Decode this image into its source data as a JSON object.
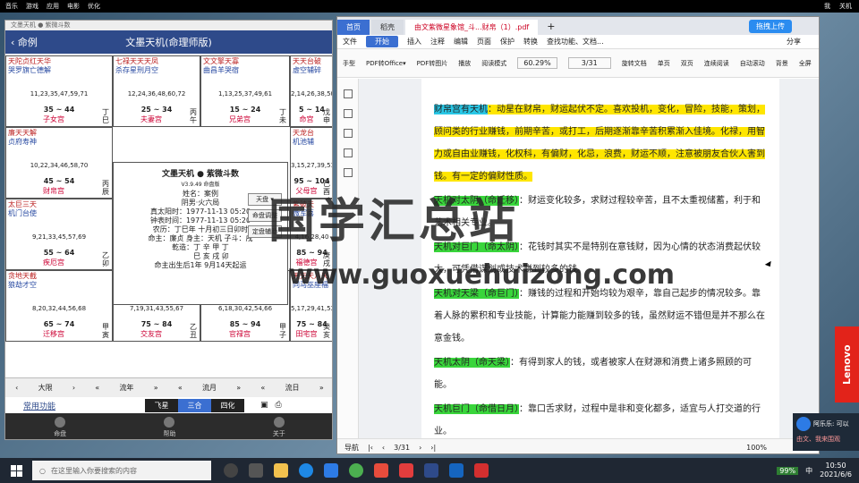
{
  "desktop_bar": {
    "items": [
      "音乐",
      "游戏",
      "应用",
      "电影",
      "优化"
    ],
    "right": [
      "我",
      "关机"
    ]
  },
  "left_app": {
    "window_title": "文墨天机 ● 紫微斗数",
    "back_label": "命例",
    "title": "文墨天机(命理师版)",
    "palaces": [
      {
        "stars": "天陀贞红天华",
        "stars2": "哭罗旗亡德解",
        "nums": "11,23,35,47,59,71",
        "range": "35 ~ 44",
        "gz": "丁巳",
        "name": "子女宫"
      },
      {
        "stars": "七禄天天天凤",
        "stars2": "杀存星刑月空",
        "nums": "12,24,36,48,60,72",
        "range": "25 ~ 34",
        "gz": "丙午",
        "name": "夫妻宫"
      },
      {
        "stars": "文文擎天寡",
        "stars2": "曲昌羊哭宿",
        "nums": "1,13,25,37,49,61",
        "range": "15 ~ 24",
        "gz": "丁未",
        "name": "兄弟宫"
      },
      {
        "stars": "天天台破",
        "stars2": "虚空辅碎",
        "nums": "2,14,26,38,50",
        "range": "5 ~ 14",
        "gz": "戊申",
        "name": "命宫"
      },
      {
        "stars": "廉天天解",
        "stars2": "贞府寿神",
        "nums": "10,22,34,46,58,70",
        "range": "45 ~ 54",
        "gz": "丙辰",
        "name": "财帛宫"
      },
      {
        "stars": "天龙台",
        "stars2": "机池辅",
        "nums": "3,15,27,39,51",
        "range": "95 ~ 104",
        "gz": "己酉",
        "name": "父母宫"
      },
      {
        "stars": "太巨三天",
        "stars2": "机门台使",
        "nums": "9,21,33,45,57,69",
        "range": "55 ~ 64",
        "gz": "乙卯",
        "name": "疾厄宫"
      },
      {
        "stars": "紫破天",
        "stars2": "微军喜",
        "nums": "4,16,28,40",
        "range": "85 ~ 94",
        "gz": "庚戌",
        "name": "福德宫"
      },
      {
        "stars": "贪地天截",
        "stars2": "狼劫才空",
        "nums": "8,20,32,44,56,68",
        "range": "65 ~ 74",
        "gz": "甲寅",
        "name": "迁移宫"
      },
      {
        "stars": "太太左右铃",
        "stars2": "阳阴辅弼星",
        "nums": "7,19,31,43,55,67",
        "range": "75 ~ 84",
        "gz": "乙丑",
        "name": "交友宫"
      },
      {
        "stars": "武天阳龙",
        "stars2": "曲府刃德",
        "nums": "6,18,30,42,54,66",
        "range": "85 ~ 94",
        "gz": "甲子",
        "name": "官禄宫"
      },
      {
        "stars": "天天天八天",
        "stars2": "同马巫座福",
        "nums": "5,17,29,41,53",
        "range": "75 ~ 84",
        "gz": "癸亥",
        "name": "田宅宫"
      }
    ],
    "center": {
      "title": "文墨天机 ● 紫微斗数",
      "sub": "V3.9.49 命盘版",
      "lines": [
        "姓名：案例",
        "阴男·火六局",
        "真太阳时：1977-11-13 05:20",
        "钟表时间：1977-11-13 05:20",
        "农历：丁巳年 十月初三日卯时",
        "命主：廉贞  身主：天机  子斗：戌",
        "乾造：丁  辛  甲  丁",
        "　　　巳  亥  戌  卯",
        "命主出生后1年 9月14天起运"
      ],
      "btn1": "天盘 ▾",
      "btn2": "命盘调整",
      "btn3": "定盘辅助"
    },
    "nav": [
      "‹",
      "大限",
      "›",
      "«",
      "流年",
      "»",
      "«",
      "流月",
      "»",
      "«",
      "流日",
      "»"
    ],
    "tools": {
      "common": "常用功能",
      "seg": [
        "飞星",
        "三合",
        "四化"
      ]
    },
    "bottom": [
      "命盘",
      "帮助",
      "关于"
    ]
  },
  "right_app": {
    "tabs": {
      "home": "首页",
      "t2": "稻壳",
      "t3": "由文紫微星象馆_斗...财帛（1）.pdf",
      "upload": "拖拽上传"
    },
    "menu": [
      "文件",
      "开始",
      "插入",
      "注释",
      "编辑",
      "页面",
      "保护",
      "转换",
      "查找功能、文档...",
      "分享"
    ],
    "toolbar": [
      "手型",
      "选择",
      "PDF转Office▾",
      "PDF转图片",
      "播放",
      "阅读模式",
      "旋转文档",
      "单页",
      "双页",
      "连续阅读",
      "自动滚动",
      "背景",
      "全屏"
    ],
    "zoom": "60.29%",
    "page_box": "3/31",
    "paragraphs": [
      {
        "hl": "财帛宫有天机",
        "hlc": "hlC",
        "text": "：动星在财帛，财运起伏不定。喜欢投机，变化，冒险，技能，策划，顾问类的行业赚钱，前期辛苦，或打工，后期逐渐靠辛苦积累渐入佳境。化禄，用智力或自由业赚钱，化权科，有偏财，化忌，浪费，财运不顺，注意被朋友合伙人害到钱。有一定的偏财性质。",
        "bg": "hlY"
      },
      {
        "hl": "天机对太阴（命迁移）",
        "hlc": "hlG",
        "text": "：财运变化较多，求财过程较辛苦，且不太重视储蓄，利于和艺术相关专业。",
        "bg": ""
      },
      {
        "hl": "天机对巨门（命太阴）",
        "hlc": "hlG",
        "text": "：花钱时其实不是特别在意钱财，因为心情的状态消费起伏较大，可凭借谋划或技术赚到较多的钱。",
        "bg": ""
      },
      {
        "hl": "天机对天梁（命巨门）",
        "hlc": "hlG",
        "text": "：赚钱的过程和开始均较为艰辛，靠自己起步的情况较多。靠着人脉的累积和专业技能，计算能力能赚到较多的钱，虽然财运不错但是并不那么在意金钱。",
        "bg": ""
      },
      {
        "hl": "天机太阴（命天梁）",
        "hlc": "hlG",
        "text": "：有得到家人的钱，或者被家人在财源和消费上诸多照顾的可能。",
        "bg": ""
      },
      {
        "hl": "天机巨门（命借日月）",
        "hlc": "hlG",
        "text": "：靠口舌求财，过程中是非和变化都多，适宜与人打交道的行业。",
        "bg": ""
      }
    ],
    "status": {
      "nav": "导航",
      "page": "3/31",
      "zoom": "100%"
    }
  },
  "watermark": {
    "cn": "国学汇总站",
    "url": "www.guoxuehuizong.com"
  },
  "notification": {
    "text": "阿乐乐: 可以",
    "sub": "由文、我来围观"
  },
  "taskbar": {
    "search": "在这里输入你要搜索的内容",
    "battery": "99%",
    "time": "10:50",
    "date": "2021/6/6",
    "lang": "中"
  }
}
